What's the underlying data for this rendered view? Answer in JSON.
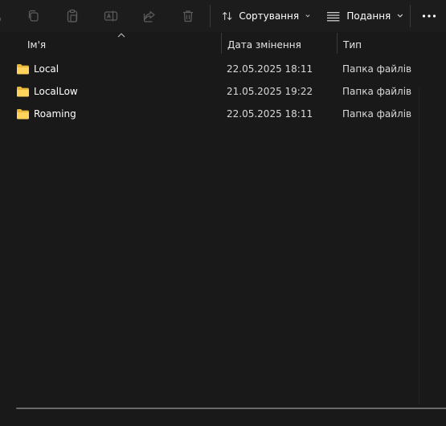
{
  "toolbar": {
    "sort_label": "Сортування",
    "view_label": "Подання",
    "icons": [
      "copy-icon",
      "paste-icon",
      "rename-icon",
      "share-icon",
      "delete-icon",
      "sort-icon",
      "view-icon",
      "more-icon"
    ]
  },
  "columns": {
    "name": "Ім'я",
    "date": "Дата змінення",
    "type": "Тип"
  },
  "files": [
    {
      "name": "Local",
      "date": "22.05.2025 18:11",
      "type": "Папка файлів"
    },
    {
      "name": "LocalLow",
      "date": "21.05.2025 19:22",
      "type": "Папка файлів"
    },
    {
      "name": "Roaming",
      "date": "22.05.2025 18:11",
      "type": "Папка файлів"
    }
  ],
  "colors": {
    "background": "#191919",
    "folder": "#f7c948",
    "text": "#ffffff"
  }
}
